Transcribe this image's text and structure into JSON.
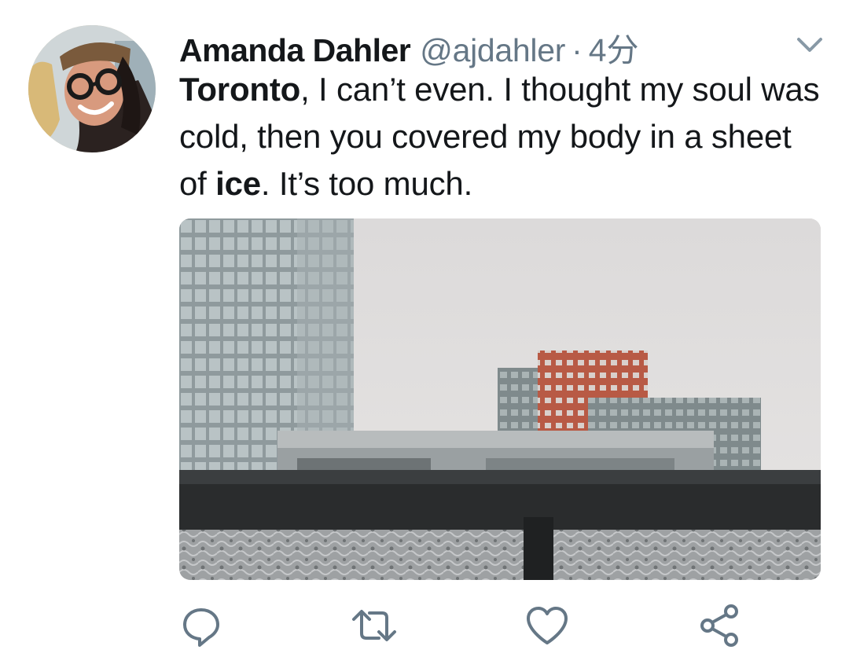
{
  "tweet": {
    "author_name": "Amanda Dahler",
    "handle": "@ajdahler",
    "separator": "·",
    "time": "4分",
    "text_segments": [
      {
        "text": "Toronto",
        "bold": true
      },
      {
        "text": ", I can’t even. I thought my soul was cold, then you covered my body in a sheet of ",
        "bold": false
      },
      {
        "text": "ice",
        "bold": true
      },
      {
        "text": ". It’s too much.",
        "bold": false
      }
    ]
  },
  "icons": {
    "caret": "chevron-down-icon",
    "reply": "reply-icon",
    "retweet": "retweet-icon",
    "like": "heart-icon",
    "share": "share-icon"
  },
  "colors": {
    "text": "#14171a",
    "secondary": "#657786",
    "icon": "#657786"
  }
}
